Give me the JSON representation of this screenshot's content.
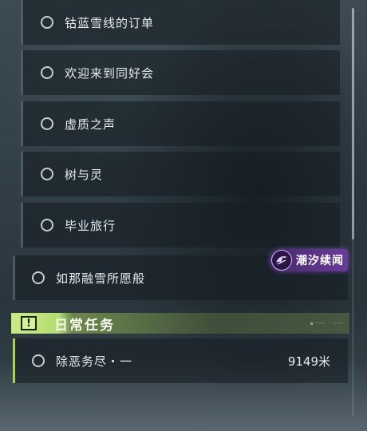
{
  "quest_list": {
    "sub_items": [
      {
        "label": "钴蓝雪线的订单"
      },
      {
        "label": "欢迎来到同好会"
      },
      {
        "label": "虚质之声"
      },
      {
        "label": "树与灵"
      },
      {
        "label": "毕业旅行"
      }
    ],
    "main_item": {
      "label": "如那融雪所愿般"
    }
  },
  "badge": {
    "label": "潮汐续闻",
    "icon": "tide-mask-icon"
  },
  "daily_tasks": {
    "header": "日常任务",
    "icon": "exclamation-box-icon",
    "items": [
      {
        "label": "除恶务尽・一",
        "distance": "9149米"
      }
    ]
  },
  "colors": {
    "accent_green": "#c8ec84",
    "badge_purple": "#6e3ca0",
    "text": "#e9ecee"
  }
}
